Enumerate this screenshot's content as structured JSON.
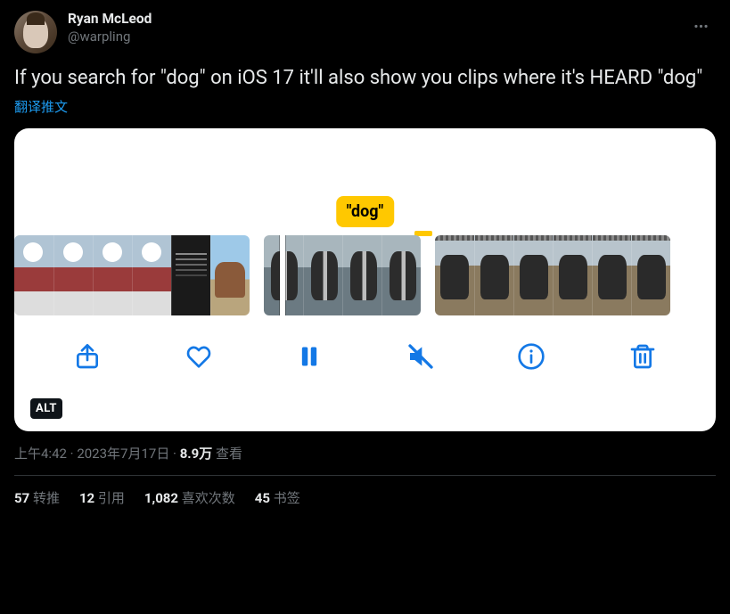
{
  "user": {
    "display_name": "Ryan McLeod",
    "handle": "@warpling"
  },
  "tweet": {
    "text": "If you search for \"dog\" on iOS 17 it'll also show you clips where it's HEARD \"dog\"",
    "translate_label": "翻译推文"
  },
  "media": {
    "recognized_label": "\"dog\"",
    "alt_badge": "ALT"
  },
  "meta": {
    "time": "上午4:42",
    "sep1": " · ",
    "date": "2023年7月17日",
    "sep2": " · ",
    "views_count": "8.9万",
    "views_label": " 查看"
  },
  "stats": {
    "retweets_count": "57",
    "retweets_label": " 转推",
    "quotes_count": "12",
    "quotes_label": " 引用",
    "likes_count": "1,082",
    "likes_label": " 喜欢次数",
    "bookmarks_count": "45",
    "bookmarks_label": " 书签"
  }
}
